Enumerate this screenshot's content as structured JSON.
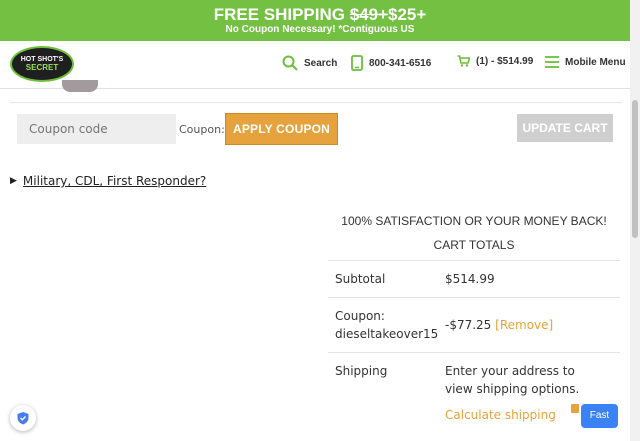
{
  "promo": {
    "prefix": "FREE SHIPPING ",
    "old_price": "$49+",
    "new_price": "$25+",
    "subtitle": "No Coupon Necessary! *Contiguous US"
  },
  "header": {
    "logo": {
      "line1": "HOT SHOT'S",
      "line2": "SECRET"
    },
    "search_label": "Search",
    "phone": "800-341-6516",
    "cart_label": "(1) - $514.99",
    "menu_label": "Mobile Menu"
  },
  "coupon": {
    "placeholder": "Coupon code",
    "label": "Coupon:",
    "apply_label": "APPLY COUPON",
    "update_label": "UPDATE CART"
  },
  "military": {
    "link_text": "Military, CDL, First Responder?"
  },
  "totals": {
    "guarantee": "100% SATISFACTION OR YOUR MONEY BACK!",
    "heading": "CART TOTALS",
    "subtotal_label": "Subtotal",
    "subtotal_value": "$514.99",
    "coupon_label": "Coupon: dieseltakeover15",
    "coupon_value": "-$77.25",
    "remove_label": "[Remove]",
    "shipping_label": "Shipping",
    "shipping_text": "Enter your address to view shipping options.",
    "calculate_label": "Calculate shipping"
  },
  "widgets": {
    "fast_label": "Fast"
  },
  "colors": {
    "promo_green": "#74c043",
    "accent_orange": "#e6a23c",
    "fast_blue": "#3b82f6"
  }
}
